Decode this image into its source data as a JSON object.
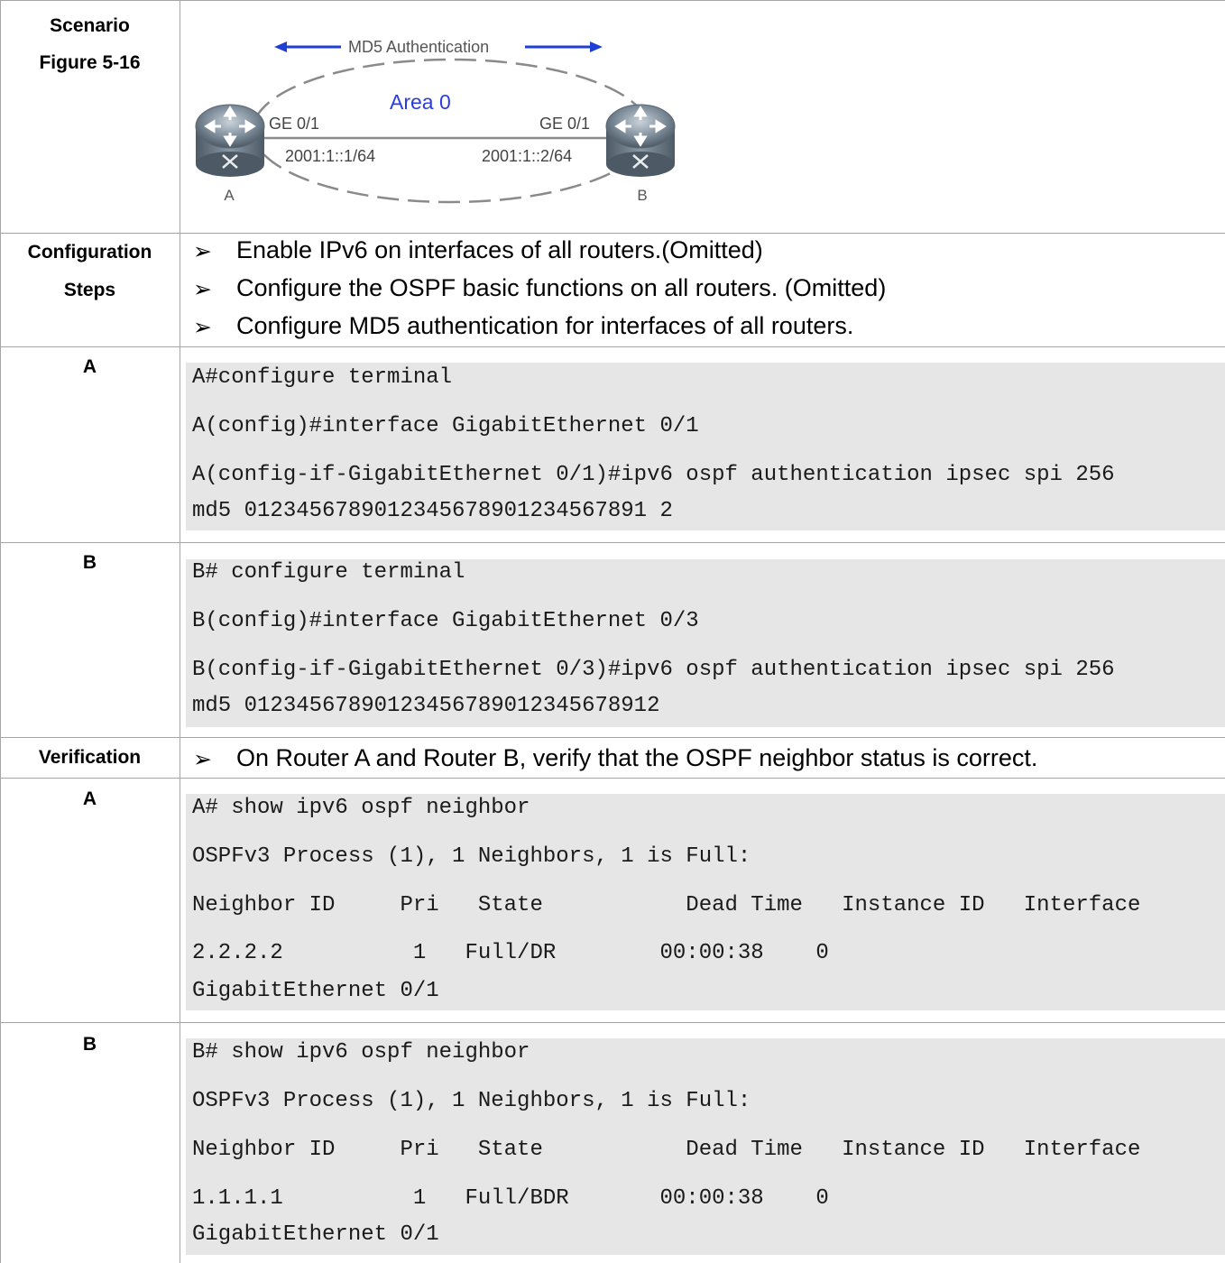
{
  "labels": {
    "scenario": "Scenario",
    "figure": "Figure 5-16",
    "config_1": "Configuration",
    "config_2": "Steps",
    "row_a1": "A",
    "row_b1": "B",
    "verification": "Verification",
    "row_a2": "A",
    "row_b2": "B"
  },
  "figure": {
    "auth_label": "MD5 Authentication",
    "area_label": "Area 0",
    "left_port": "GE 0/1",
    "right_port": "GE 0/1",
    "left_ip": "2001:1::1/64",
    "right_ip": "2001:1::2/64",
    "left_router": "A",
    "right_router": "B",
    "arrow_color": "#1f3fd4",
    "area_color": "#2a3de0"
  },
  "bullet_symbol": "➢",
  "config_steps": [
    "Enable IPv6 on interfaces of all routers.(Omitted)",
    "Configure the OSPF basic functions on all routers. (Omitted)",
    "Configure MD5 authentication for interfaces of all routers."
  ],
  "code_a1": [
    "A#configure terminal",
    "A(config)#interface GigabitEthernet 0/1",
    "A(config-if-GigabitEthernet 0/1)#ipv6 ospf authentication ipsec spi 256",
    "md5 0123456789012345678901234567891 2"
  ],
  "code_b1": [
    "B# configure terminal",
    "B(config)#interface GigabitEthernet 0/3",
    "B(config-if-GigabitEthernet 0/3)#ipv6 ospf authentication ipsec spi 256",
    "md5 01234567890123456789012345678912"
  ],
  "verification_steps": [
    "On Router A and Router B, verify that the OSPF neighbor status is correct."
  ],
  "code_a2": [
    "A# show ipv6 ospf neighbor",
    "OSPFv3 Process (1), 1 Neighbors, 1 is Full:",
    "Neighbor ID     Pri   State           Dead Time   Instance ID   Interface",
    "2.2.2.2          1   Full/DR        00:00:38    0",
    "GigabitEthernet 0/1"
  ],
  "code_b2": [
    "B# show ipv6 ospf neighbor",
    "OSPFv3 Process (1), 1 Neighbors, 1 is Full:",
    "Neighbor ID     Pri   State           Dead Time   Instance ID   Interface",
    "1.1.1.1          1   Full/BDR       00:00:38    0",
    "GigabitEthernet 0/1"
  ]
}
